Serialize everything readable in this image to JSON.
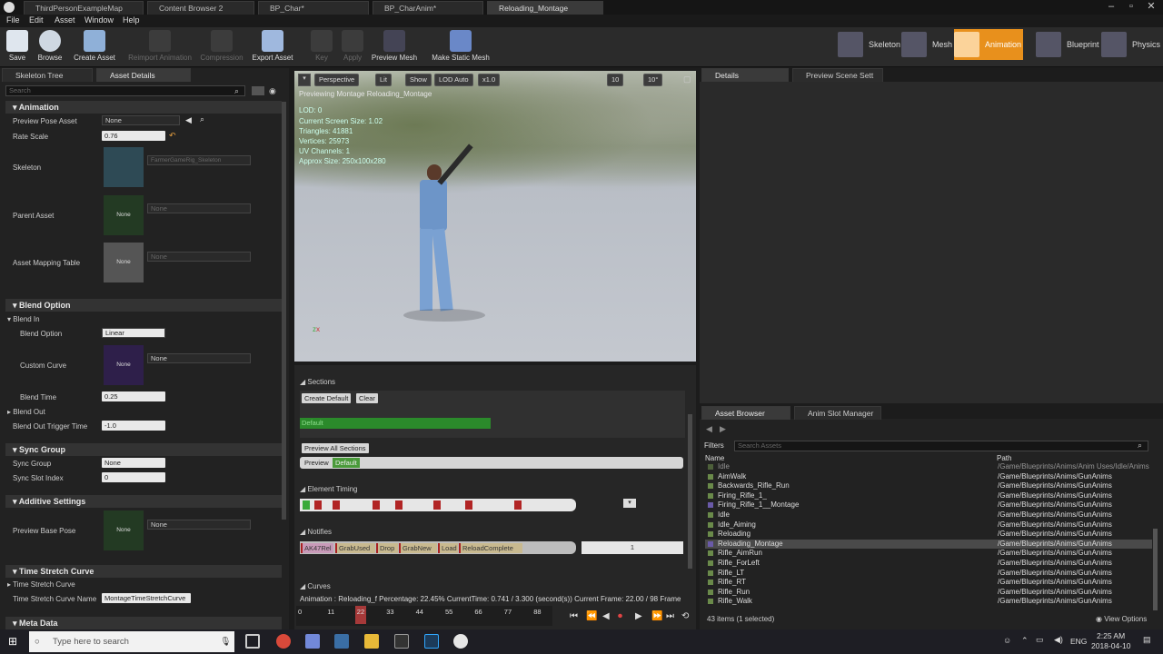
{
  "window": {
    "tabs": [
      {
        "label": "ThirdPersonExampleMap",
        "active": false
      },
      {
        "label": "Content Browser 2",
        "active": false
      },
      {
        "label": "BP_Char*",
        "active": false
      },
      {
        "label": "BP_CharAnim*",
        "active": false
      },
      {
        "label": "Reloading_Montage",
        "active": true
      }
    ]
  },
  "menu": [
    "File",
    "Edit",
    "Asset",
    "Window",
    "Help"
  ],
  "toolbar": {
    "save": "Save",
    "browse": "Browse",
    "create_asset": "Create Asset",
    "reimport": "Reimport Animation",
    "compression": "Compression",
    "export": "Export Asset",
    "key": "Key",
    "apply": "Apply",
    "preview_mesh": "Preview Mesh",
    "make_static": "Make Static Mesh"
  },
  "modes": {
    "skeleton": "Skeleton",
    "mesh": "Mesh",
    "animation": "Animation",
    "blueprint": "Blueprint",
    "physics": "Physics"
  },
  "left": {
    "tab_skeleton": "Skeleton Tree",
    "tab_asset": "Asset Details",
    "search_placeholder": "Search",
    "animation": {
      "title": "Animation",
      "preview_pose_label": "Preview Pose Asset",
      "preview_pose_value": "None",
      "rate_label": "Rate Scale",
      "rate_value": "0.76",
      "skeleton_label": "Skeleton",
      "skeleton_value": "FarmerGameRig_Skeleton",
      "parent_label": "Parent Asset",
      "parent_value": "None",
      "parent_thumb": "None",
      "mapping_label": "Asset Mapping Table",
      "mapping_value": "None",
      "mapping_thumb": "None"
    },
    "blend": {
      "title": "Blend Option",
      "blend_in": "Blend In",
      "option_label": "Blend Option",
      "option_value": "Linear",
      "curve_label": "Custom Curve",
      "curve_value": "None",
      "curve_thumb": "None",
      "time_label": "Blend Time",
      "time_value": "0.25",
      "blend_out": "Blend Out",
      "trigger_label": "Blend Out Trigger Time",
      "trigger_value": "-1.0"
    },
    "sync": {
      "title": "Sync Group",
      "group_label": "Sync Group",
      "group_value": "None",
      "slot_label": "Sync Slot Index",
      "slot_value": "0"
    },
    "additive": {
      "title": "Additive Settings",
      "base_label": "Preview Base Pose",
      "base_value": "None",
      "base_thumb": "None"
    },
    "stretch": {
      "title": "Time Stretch Curve",
      "sub": "Time Stretch Curve",
      "name_label": "Time Stretch Curve Name",
      "name_value": "MontageTimeStretchCurve"
    },
    "meta": "Meta Data"
  },
  "viewport": {
    "perspective": "Perspective",
    "lit": "Lit",
    "show": "Show",
    "lod": "LOD Auto",
    "speed": "x1.0",
    "grid": "10",
    "angle": "10°",
    "stats": [
      "Previewing Montage Reloading_Montage",
      "LOD: 0",
      "Current Screen Size: 1.02",
      "Triangles: 41881",
      "Vertices: 25973",
      "UV Channels: 1",
      "Approx Size: 250x100x280"
    ]
  },
  "montage": {
    "sections": "Sections",
    "create_default": "Create Default",
    "clear": "Clear",
    "default_label": "Default",
    "preview_all": "Preview All Sections",
    "preview": "Preview",
    "element_timing": "Element Timing",
    "notifies": "Notifies",
    "notify_items": [
      "AK47Rel",
      "GrabUsed",
      "Drop",
      "GrabNew",
      "Load",
      "ReloadComplete"
    ],
    "notify_track": "1",
    "curves": "Curves",
    "status": "Animation : Reloading_f Percentage: 22.45% CurrentTime: 0.741 / 3.300 (second(s)) Current Frame: 22.00 / 98 Frame",
    "ticks": [
      "0",
      "11",
      "22",
      "33",
      "44",
      "55",
      "66",
      "77",
      "88"
    ],
    "progress_percent": 22.45
  },
  "right": {
    "tab_details": "Details",
    "tab_scene": "Preview Scene Sett"
  },
  "assets": {
    "tab_browser": "Asset Browser",
    "tab_slot": "Anim Slot Manager",
    "filters": "Filters",
    "search_placeholder": "Search Assets",
    "col_name": "Name",
    "col_path": "Path",
    "rows": [
      {
        "name": "Idle",
        "path": "/Game/Blueprints/Anims/Anim Uses/Idle/Anims"
      },
      {
        "name": "AimWalk",
        "path": "/Game/Blueprints/Anims/GunAnims"
      },
      {
        "name": "Backwards_Rifle_Run",
        "path": "/Game/Blueprints/Anims/GunAnims"
      },
      {
        "name": "Firing_Rifle_1_",
        "path": "/Game/Blueprints/Anims/GunAnims"
      },
      {
        "name": "Firing_Rifle_1__Montage",
        "path": "/Game/Blueprints/Anims/GunAnims"
      },
      {
        "name": "Idle",
        "path": "/Game/Blueprints/Anims/GunAnims"
      },
      {
        "name": "Idle_Aiming",
        "path": "/Game/Blueprints/Anims/GunAnims"
      },
      {
        "name": "Reloading",
        "path": "/Game/Blueprints/Anims/GunAnims"
      },
      {
        "name": "Reloading_Montage",
        "path": "/Game/Blueprints/Anims/GunAnims"
      },
      {
        "name": "Rifle_AimRun",
        "path": "/Game/Blueprints/Anims/GunAnims"
      },
      {
        "name": "Rifle_ForLeft",
        "path": "/Game/Blueprints/Anims/GunAnims"
      },
      {
        "name": "Rifle_LT",
        "path": "/Game/Blueprints/Anims/GunAnims"
      },
      {
        "name": "Rifle_RT",
        "path": "/Game/Blueprints/Anims/GunAnims"
      },
      {
        "name": "Rifle_Run",
        "path": "/Game/Blueprints/Anims/GunAnims"
      },
      {
        "name": "Rifle_Walk",
        "path": "/Game/Blueprints/Anims/GunAnims"
      }
    ],
    "count": "43 items (1 selected)",
    "view_options": "View Options"
  },
  "taskbar": {
    "search": "Type here to search",
    "lang": "ENG",
    "time": "2:25 AM",
    "date": "2018-04-10"
  },
  "colors": {
    "accent": "#e8901c",
    "green": "#2b8a2b",
    "marker": "#b12424"
  }
}
